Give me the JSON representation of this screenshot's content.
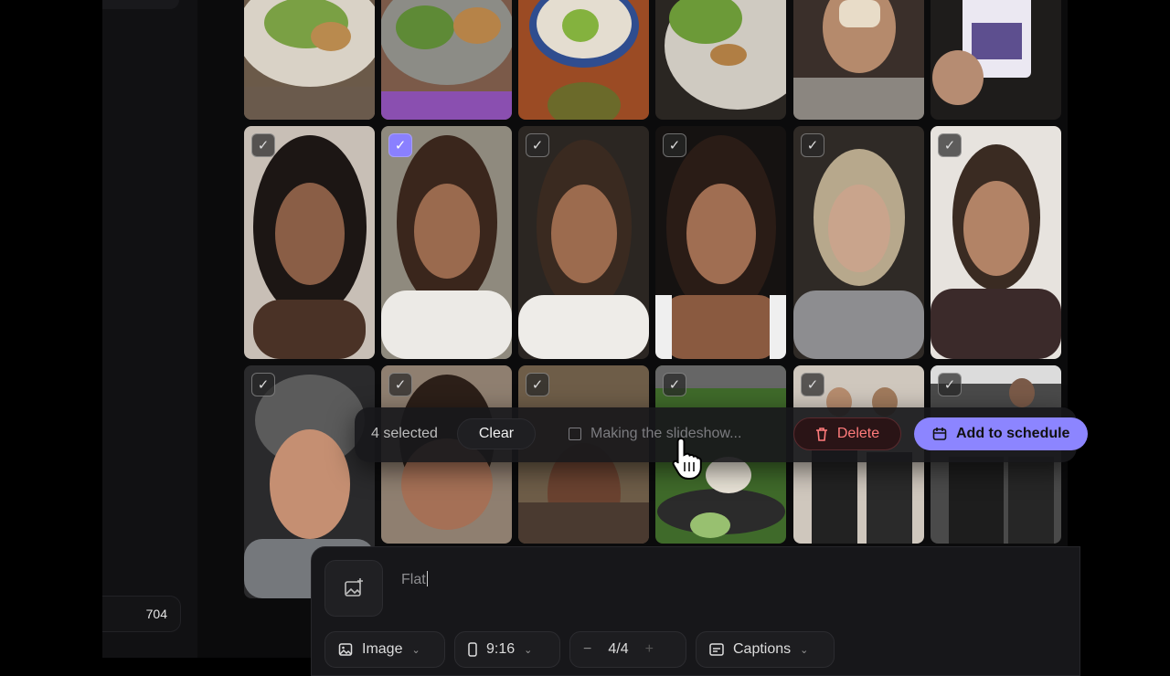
{
  "sidebar": {
    "count": "704"
  },
  "grid": {
    "rows": [
      [
        {
          "checked": null
        },
        {
          "checked": null
        },
        {
          "checked": null
        },
        {
          "checked": null
        },
        {
          "checked": null
        },
        {
          "checked": null
        }
      ],
      [
        {
          "checked": false
        },
        {
          "checked": true
        },
        {
          "checked": false
        },
        {
          "checked": false
        },
        {
          "checked": false
        },
        {
          "checked": false
        }
      ],
      [
        {
          "checked": false
        },
        {
          "checked": false
        },
        {
          "checked": false
        },
        {
          "checked": false
        },
        {
          "checked": false
        },
        {
          "checked": false
        }
      ]
    ],
    "accent": "#8a80ff"
  },
  "selection_bar": {
    "count_label": "4 selected",
    "clear_label": "Clear",
    "status_label": "Making the slideshow...",
    "delete_label": "Delete",
    "schedule_label": "Add to schedule"
  },
  "composer": {
    "prompt_value": "Flat",
    "image_chip": "Image",
    "ratio_chip": "9:16",
    "count_chip": "4/4",
    "captions_chip": "Captions"
  },
  "colors": {
    "delete": "#ff7b7b",
    "primary": "#8c85ff"
  }
}
